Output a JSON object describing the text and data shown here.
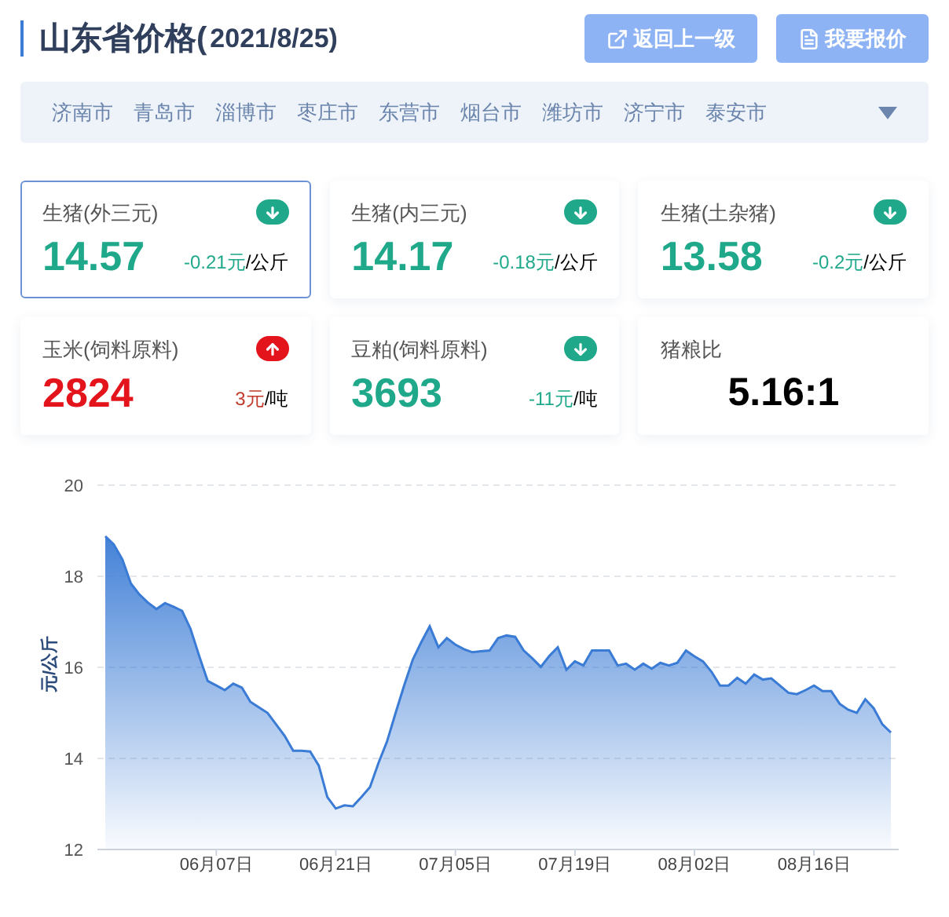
{
  "header": {
    "title": "山东省价格(",
    "date": "2021/8/25)"
  },
  "buttons": [
    {
      "kind": "back",
      "label": "返回上一级"
    },
    {
      "kind": "report",
      "label": "我要报价"
    }
  ],
  "cities": [
    "济南市",
    "青岛市",
    "淄博市",
    "枣庄市",
    "东营市",
    "烟台市",
    "潍坊市",
    "济宁市",
    "泰安市"
  ],
  "cards": [
    {
      "kind": "price",
      "name": "生猪(外三元)",
      "rising": false,
      "value": "14.57",
      "change": "-0.21元",
      "unit": "/公斤",
      "selected": true
    },
    {
      "kind": "price",
      "name": "生猪(内三元)",
      "rising": false,
      "value": "14.17",
      "change": "-0.18元",
      "unit": "/公斤",
      "selected": false
    },
    {
      "kind": "price",
      "name": "生猪(土杂猪)",
      "rising": false,
      "value": "13.58",
      "change": "-0.2元",
      "unit": "/公斤",
      "selected": false
    },
    {
      "kind": "price",
      "name": "玉米(饲料原料)",
      "rising": true,
      "value": "2824",
      "change": "3元",
      "unit": "/吨",
      "selected": false
    },
    {
      "kind": "price",
      "name": "豆粕(饲料原料)",
      "rising": false,
      "value": "3693",
      "change": "-11元",
      "unit": "/吨",
      "selected": false
    },
    {
      "kind": "ratio",
      "name": "猪粮比",
      "value": "5.16:1",
      "selected": false
    }
  ],
  "chart": {
    "chart_data": {
      "type": "area",
      "ylabel": "元/公斤",
      "ylim": [
        12,
        20
      ],
      "yticks": [
        12,
        14,
        16,
        18,
        20
      ],
      "grid": true,
      "categories": [
        null,
        null,
        null,
        null,
        null,
        null,
        null,
        null,
        null,
        null,
        null,
        null,
        null,
        "06月07日",
        null,
        null,
        null,
        null,
        null,
        null,
        null,
        null,
        null,
        null,
        null,
        null,
        null,
        "06月21日",
        null,
        null,
        null,
        null,
        null,
        null,
        null,
        null,
        null,
        null,
        null,
        null,
        null,
        "07月05日",
        null,
        null,
        null,
        null,
        null,
        null,
        null,
        null,
        null,
        null,
        null,
        null,
        null,
        "07月19日",
        null,
        null,
        null,
        null,
        null,
        null,
        null,
        null,
        null,
        null,
        null,
        null,
        null,
        "08月02日",
        null,
        null,
        null,
        null,
        null,
        null,
        null,
        null,
        null,
        null,
        null,
        null,
        null,
        "08月16日",
        null,
        null,
        null,
        null,
        null,
        null,
        null,
        null,
        null
      ],
      "series": [
        {
          "color": "#3a7bd5",
          "values": [
            18.88,
            18.7,
            18.37,
            17.84,
            17.6,
            17.42,
            17.28,
            17.41,
            17.33,
            17.24,
            16.84,
            16.25,
            15.7,
            15.6,
            15.5,
            15.64,
            15.55,
            15.24,
            15.12,
            15.0,
            14.75,
            14.5,
            14.17,
            14.17,
            14.15,
            13.84,
            13.15,
            12.9,
            12.97,
            12.95,
            13.15,
            13.37,
            13.9,
            14.37,
            15.0,
            15.6,
            16.17,
            16.55,
            16.9,
            16.44,
            16.64,
            16.5,
            16.4,
            16.33,
            16.35,
            16.37,
            16.64,
            16.7,
            16.67,
            16.37,
            16.2,
            16.01,
            16.25,
            16.44,
            15.95,
            16.13,
            16.04,
            16.37,
            16.37,
            16.37,
            16.04,
            16.08,
            15.95,
            16.08,
            15.97,
            16.1,
            16.04,
            16.1,
            16.37,
            16.24,
            16.13,
            15.9,
            15.6,
            15.6,
            15.77,
            15.64,
            15.84,
            15.73,
            15.76,
            15.6,
            15.44,
            15.41,
            15.5,
            15.6,
            15.48,
            15.48,
            15.2,
            15.07,
            15.0,
            15.3,
            15.1,
            14.75,
            14.57
          ]
        }
      ]
    }
  }
}
